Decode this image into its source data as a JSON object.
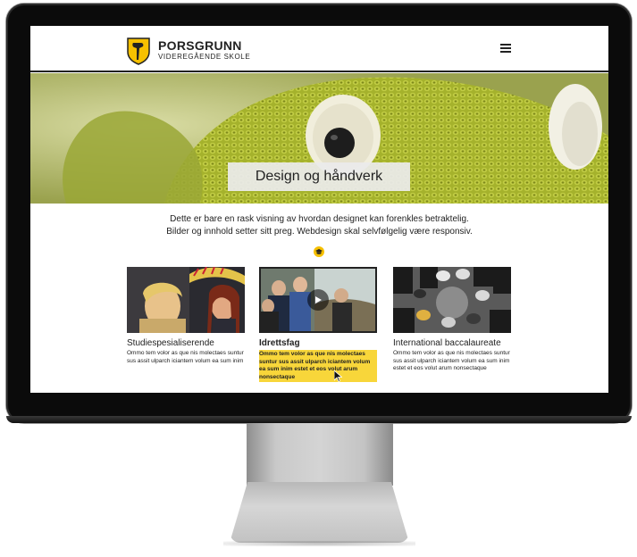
{
  "header": {
    "brand_name": "PORSGRUNN",
    "brand_sub": "VIDEREGÅENDE SKOLE",
    "logo_icon": "shield-axe-icon",
    "menu_icon": "hamburger-menu-icon"
  },
  "hero": {
    "title": "Design og håndverk"
  },
  "intro": {
    "line1": "Dette er bare en rask visning av hvordan designet kan forenkles betraktelig.",
    "line2": "Bilder og innhold setter sitt preg. Webdesign skal selvfølgelig være responsiv.",
    "badge_icon": "graduation-cap-icon"
  },
  "cards": [
    {
      "title": "Studiespesialiserende",
      "text": "Ommo tem volor as que nis molectaes suntur sus assit ulparch iciantem volum ea sum inim"
    },
    {
      "title": "Idrettsfag",
      "text": "Ommo tem volor as que nis molectaes suntur sus assit ulparch iciantem volum ea sum inim estet et eos volut arum nonsectaque",
      "play_icon": "play-icon"
    },
    {
      "title": "International baccalaureate",
      "text": "Ommo tem volor as que nis molectaes suntur sus assit ulparch iciantem volum ea sum inim estet et eos volut arum nonsectaque"
    }
  ],
  "colors": {
    "accent": "#f6c000",
    "highlight": "#f8d63a",
    "text": "#222222"
  }
}
